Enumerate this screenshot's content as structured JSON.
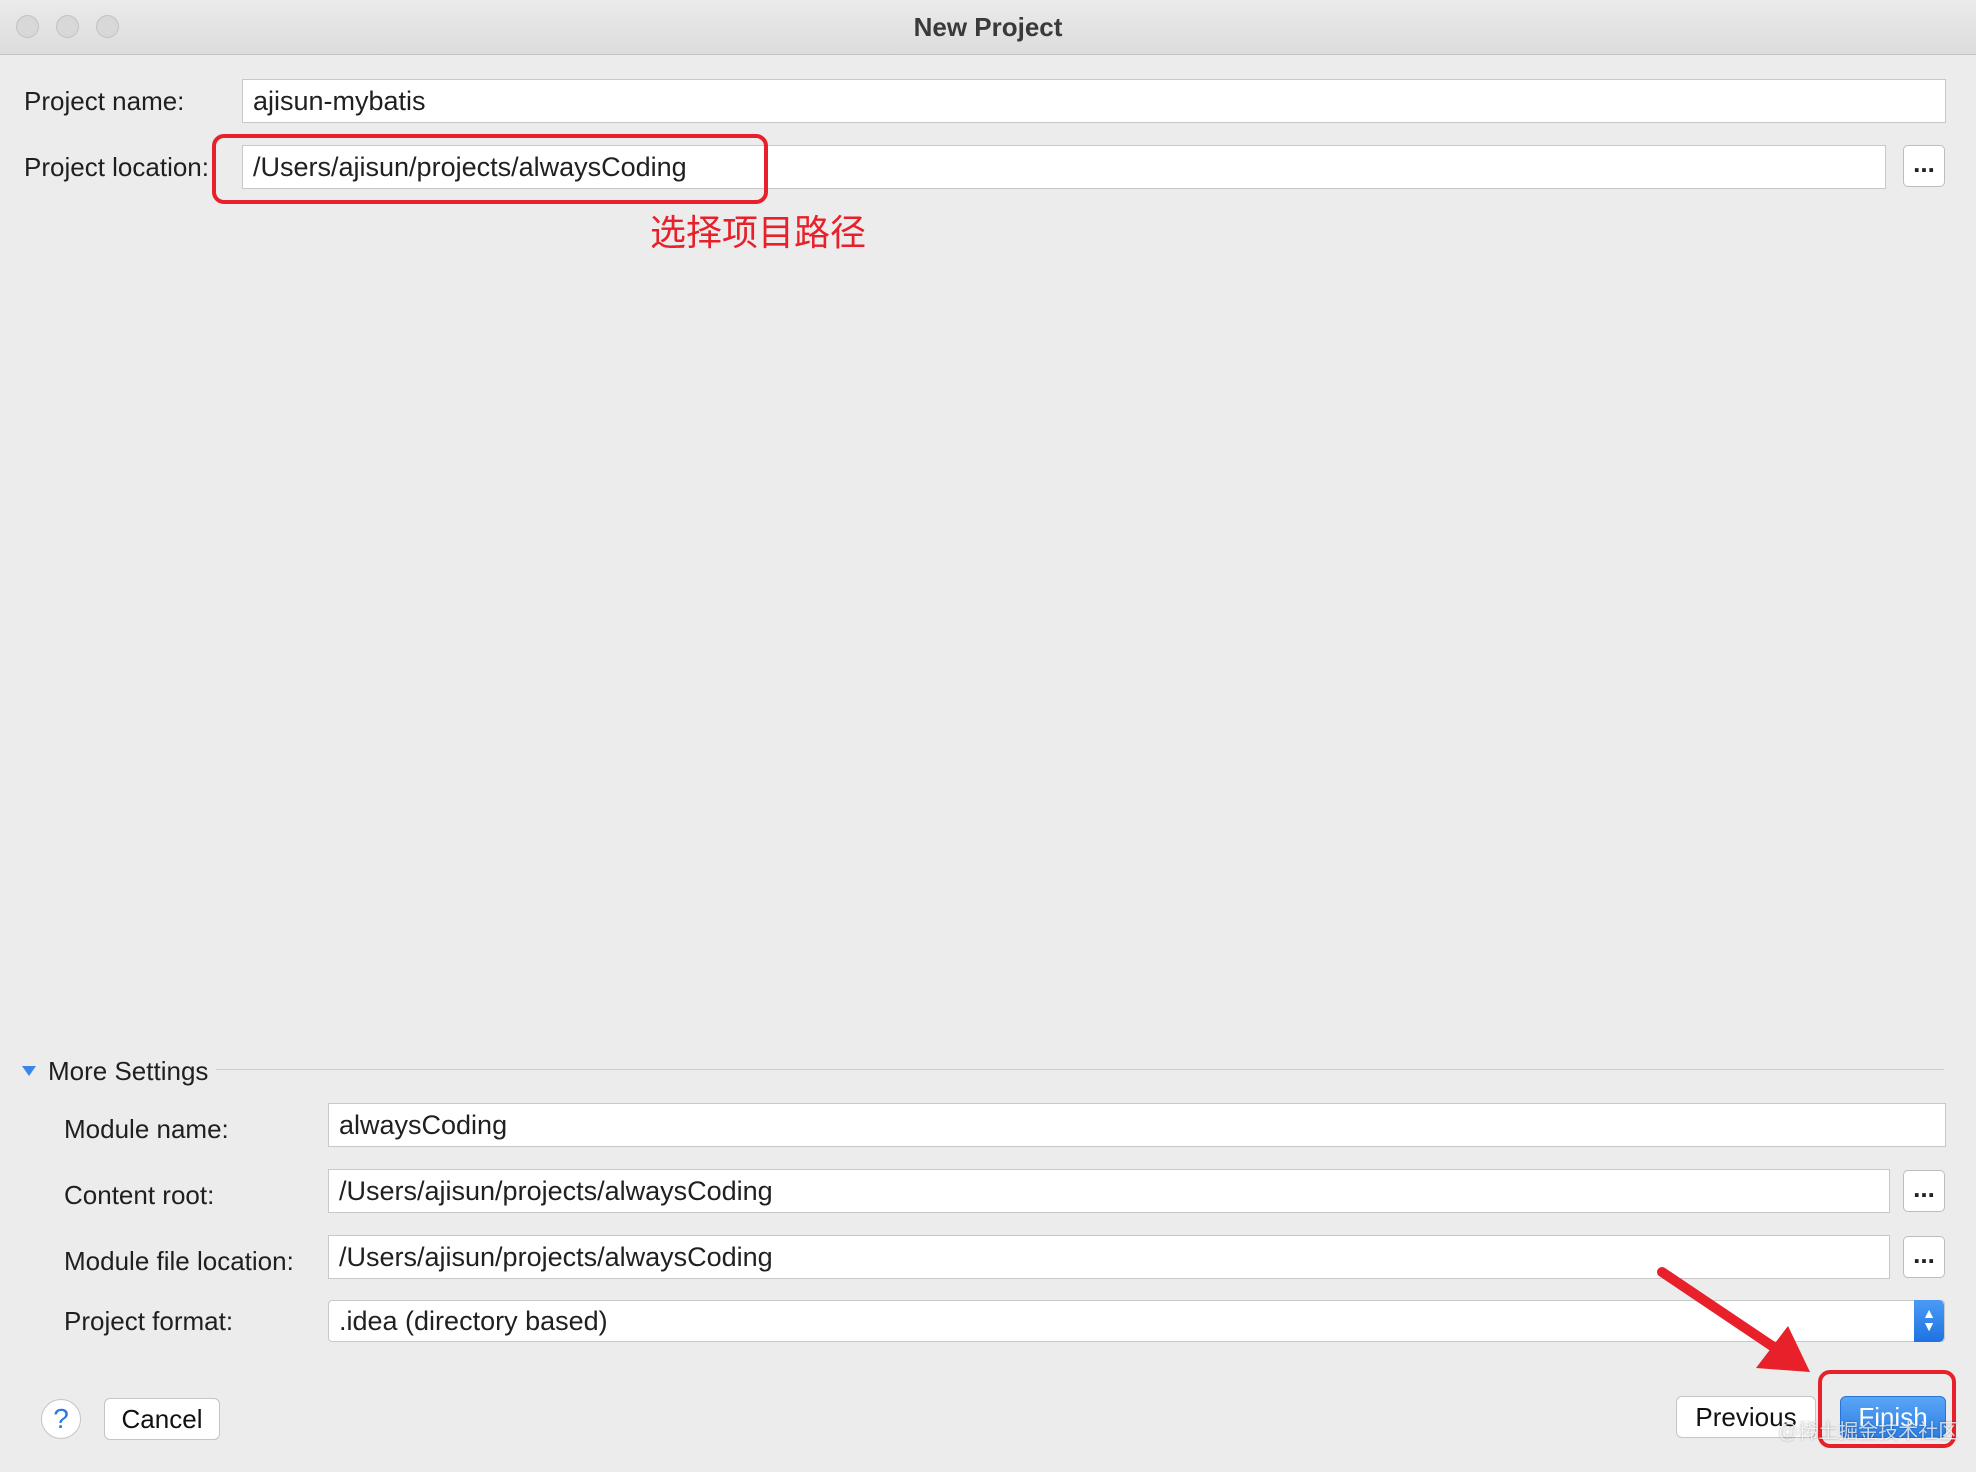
{
  "window": {
    "title": "New Project"
  },
  "form": {
    "project_name_label": "Project name:",
    "project_name_value": "ajisun-mybatis",
    "project_location_label": "Project location:",
    "project_location_value": "/Users/ajisun/projects/alwaysCoding",
    "browse_label": "..."
  },
  "annotations": {
    "location_note": "选择项目路径",
    "color": "#e8202a"
  },
  "more_settings": {
    "header": "More Settings",
    "module_name_label": "Module name:",
    "module_name_value": "alwaysCoding",
    "content_root_label": "Content root:",
    "content_root_value": "/Users/ajisun/projects/alwaysCoding",
    "module_file_location_label": "Module file location:",
    "module_file_location_value": "/Users/ajisun/projects/alwaysCoding",
    "project_format_label": "Project format:",
    "project_format_value": ".idea (directory based)"
  },
  "footer": {
    "help_label": "?",
    "cancel_label": "Cancel",
    "previous_label": "Previous",
    "finish_label": "Finish",
    "watermark": "@稀土掘金技术社区"
  },
  "colors": {
    "accent": "#2b7fe5",
    "annotation": "#e8202a",
    "background": "#ececec"
  }
}
